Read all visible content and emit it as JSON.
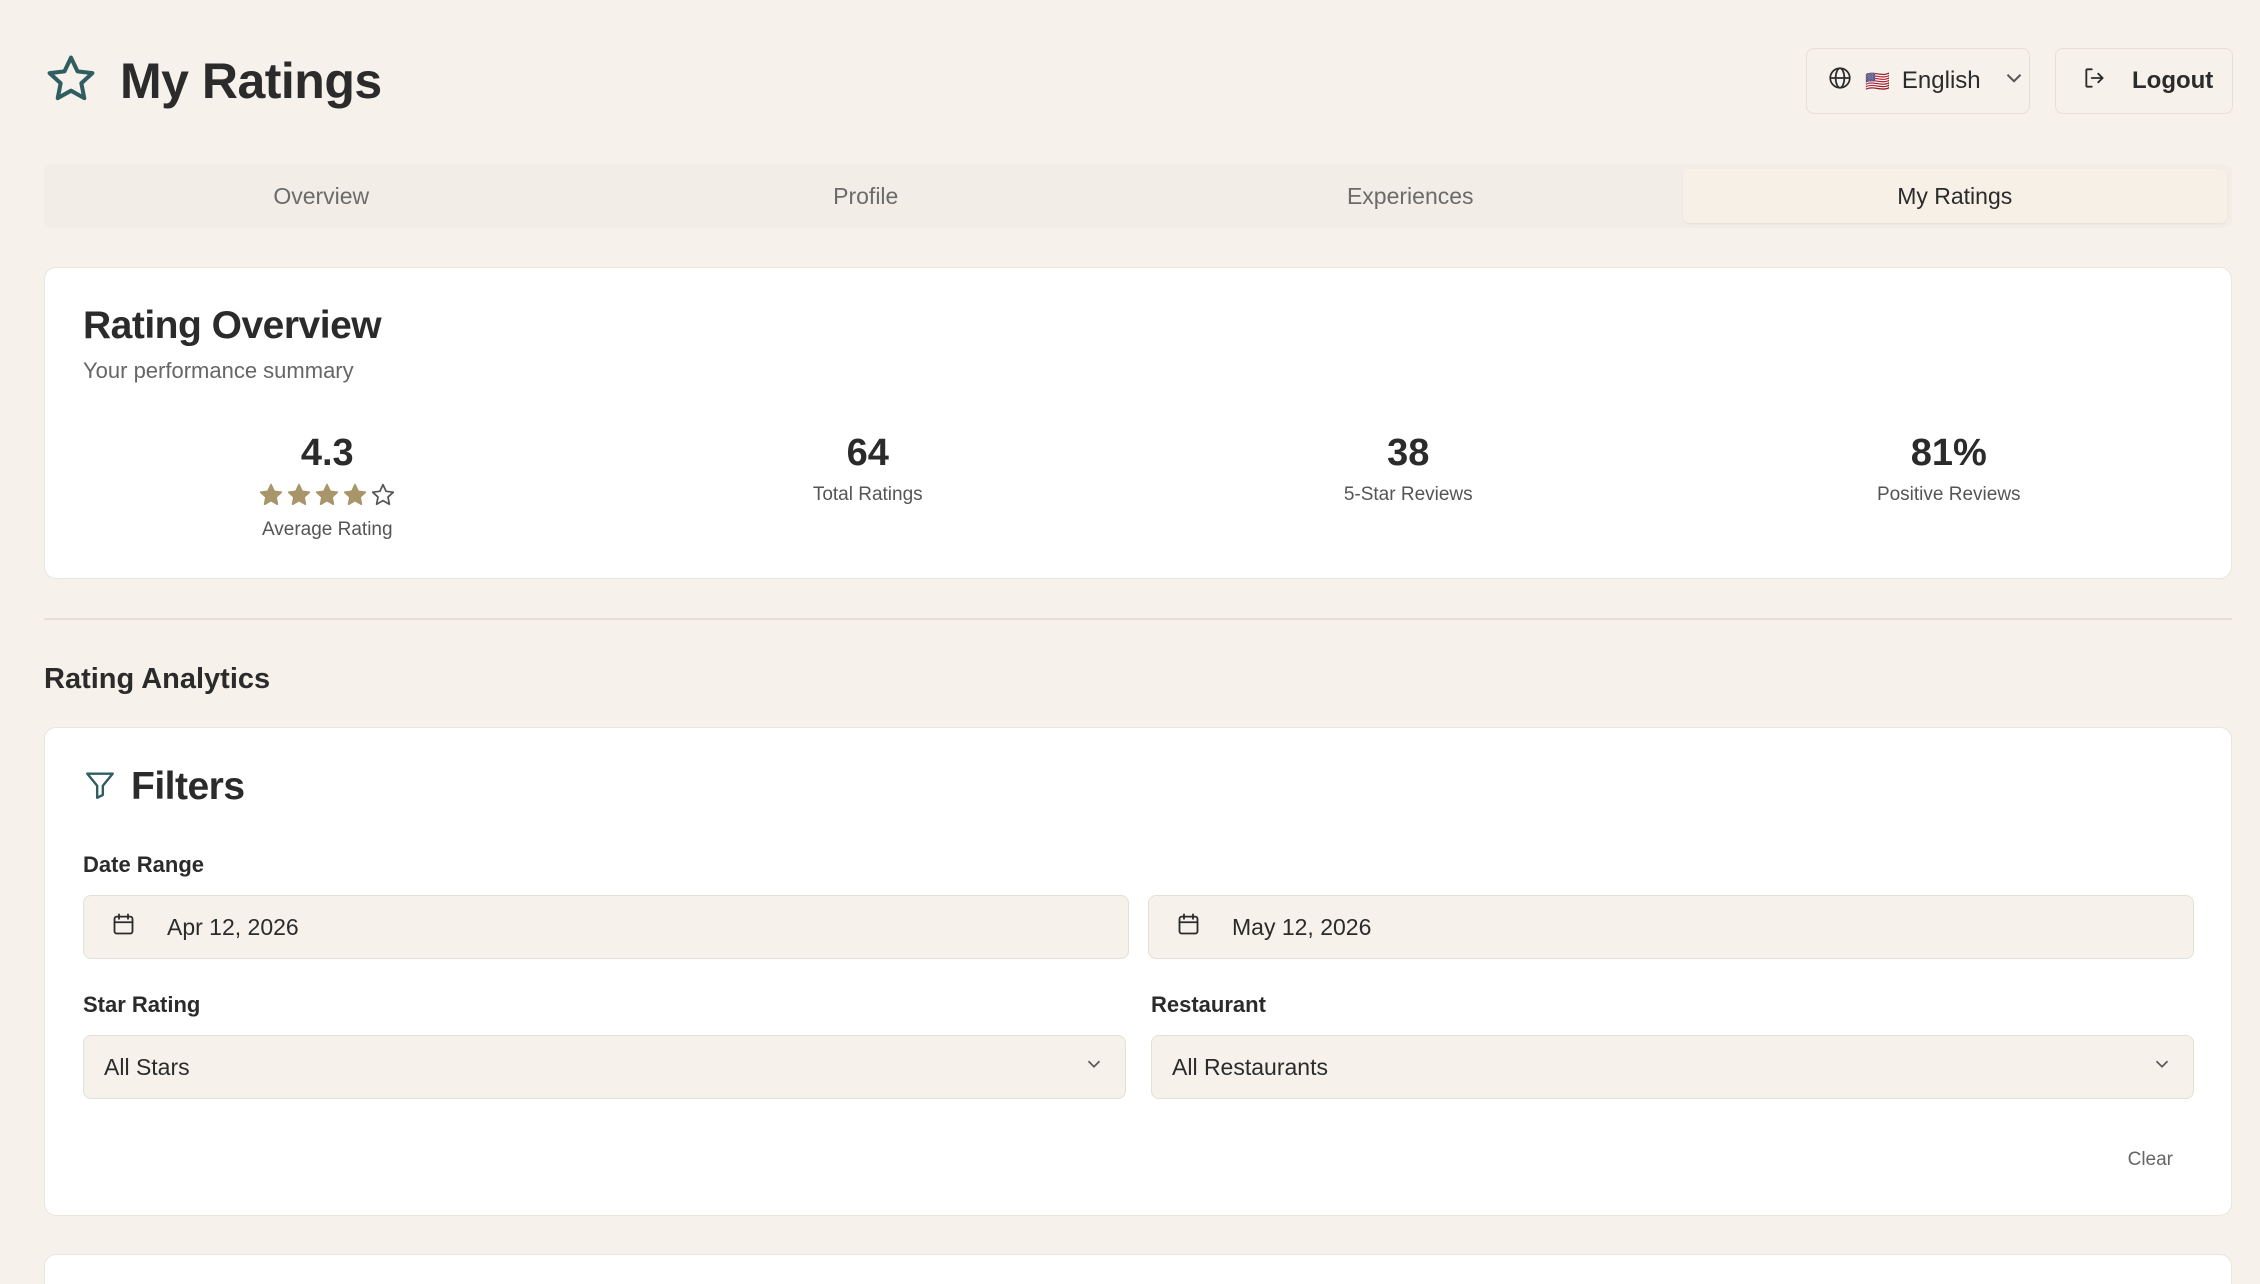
{
  "header": {
    "title": "My Ratings",
    "language_label": "English",
    "language_flag": "🇺🇸",
    "logout_label": "Logout",
    "accent_color": "#2f5d62"
  },
  "tabs": [
    {
      "label": "Overview",
      "active": false
    },
    {
      "label": "Profile",
      "active": false
    },
    {
      "label": "Experiences",
      "active": false
    },
    {
      "label": "My Ratings",
      "active": true
    }
  ],
  "overview": {
    "title": "Rating Overview",
    "subtitle": "Your performance summary",
    "stats": [
      {
        "value": "4.3",
        "label": "Average Rating",
        "stars_filled": 4,
        "stars_total": 5
      },
      {
        "value": "64",
        "label": "Total Ratings"
      },
      {
        "value": "38",
        "label": "5-Star Reviews"
      },
      {
        "value": "81%",
        "label": "Positive Reviews"
      }
    ],
    "star_color": "#a8966a"
  },
  "analytics": {
    "section_title": "Rating Analytics"
  },
  "filters": {
    "title": "Filters",
    "date_range_label": "Date Range",
    "date_from": "Apr 12, 2026",
    "date_to": "May 12, 2026",
    "star_rating_label": "Star Rating",
    "star_rating_value": "All Stars",
    "restaurant_label": "Restaurant",
    "restaurant_value": "All Restaurants",
    "clear_label": "Clear"
  }
}
